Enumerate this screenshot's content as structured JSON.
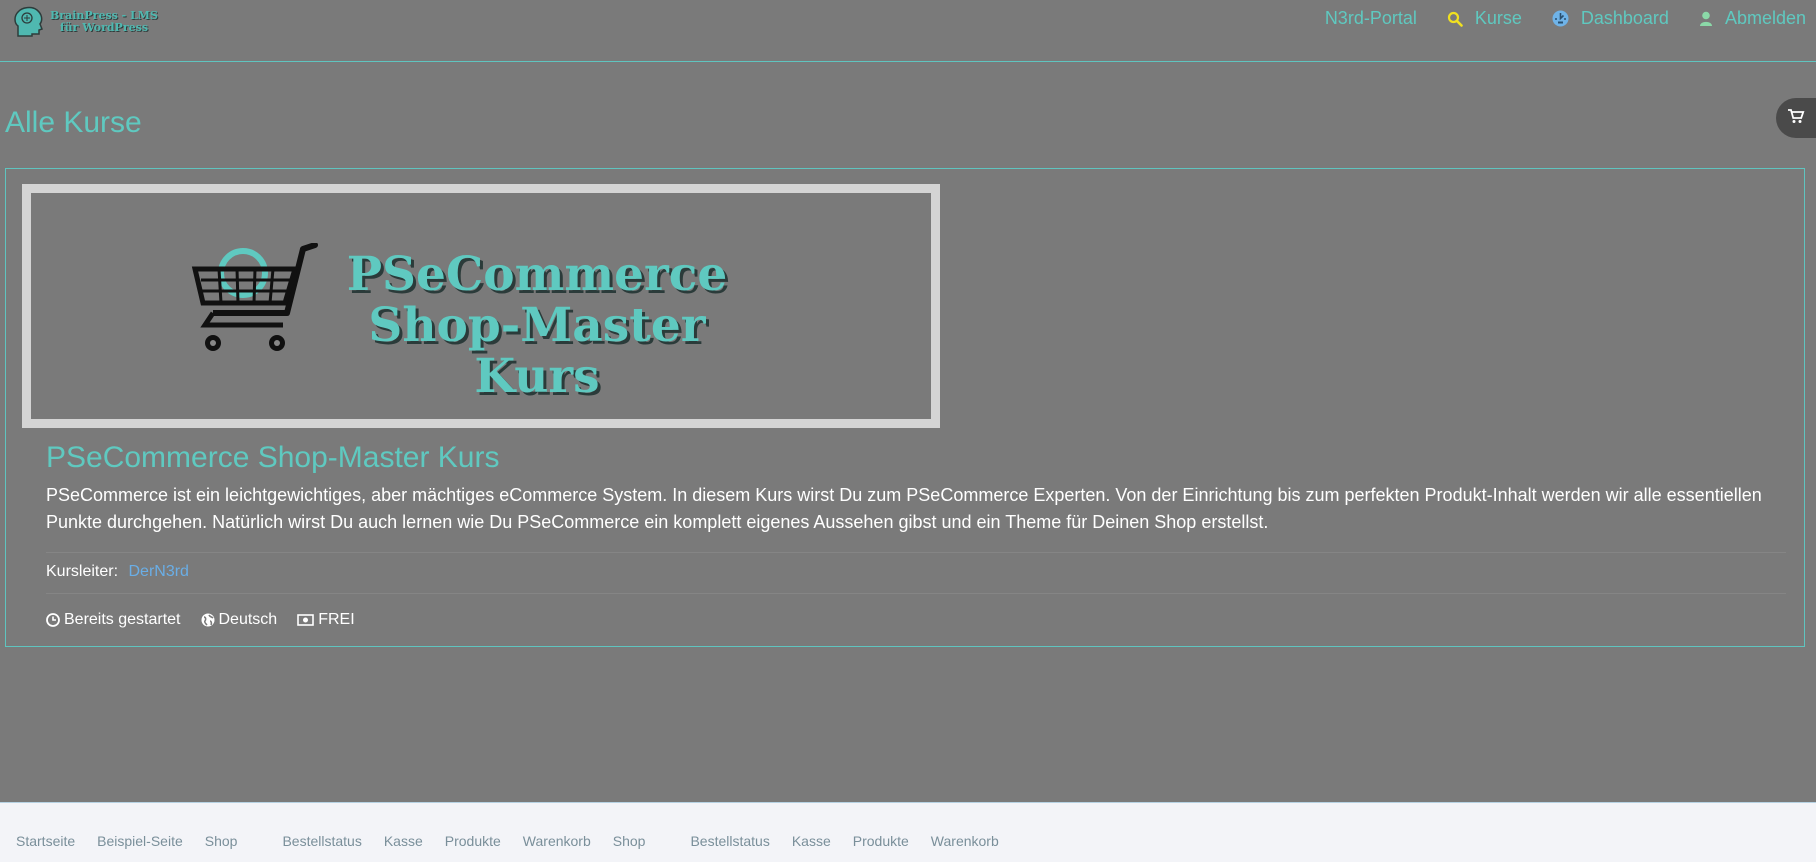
{
  "header": {
    "logo_text_line1": "BrainPress - LMS",
    "logo_text_line2": "für WordPress",
    "nav": [
      {
        "label": "N3rd-Portal",
        "icon": ""
      },
      {
        "label": "Kurse",
        "icon": "search-icon"
      },
      {
        "label": "Dashboard",
        "icon": "dashboard-icon"
      },
      {
        "label": "Abmelden",
        "icon": "user-icon"
      }
    ]
  },
  "page": {
    "title": "Alle Kurse"
  },
  "course": {
    "image_title_line1": "PSeCommerce",
    "image_title_line2": "Shop-Master Kurs",
    "title": "PSeCommerce Shop-Master Kurs",
    "description": "PSeCommerce ist ein leichtgewichtiges, aber mächtiges eCommerce System. In diesem Kurs wirst Du zum PSeCommerce Experten. Von der Einrichtung bis zum perfekten Produkt-Inhalt werden wir alle essentiellen Punkte durchgehen. Natürlich wirst Du auch lernen wie Du PSeCommerce ein komplett eigenes Aussehen gibst und ein Theme für Deinen Shop erstellst.",
    "instructor_label": "Kursleiter:",
    "instructor_name": "DerN3rd",
    "meta": {
      "status": "Bereits gestartet",
      "language": "Deutsch",
      "price": "FREI"
    }
  },
  "footer": {
    "links": [
      "Startseite",
      "Beispiel-Seite",
      "Shop",
      "Bestellstatus",
      "Kasse",
      "Produkte",
      "Warenkorb",
      "Shop",
      "Bestellstatus",
      "Kasse",
      "Produkte",
      "Warenkorb"
    ]
  },
  "colors": {
    "accent": "#5fc9c0",
    "background": "#7a7a7a",
    "link": "#6aaee6"
  }
}
